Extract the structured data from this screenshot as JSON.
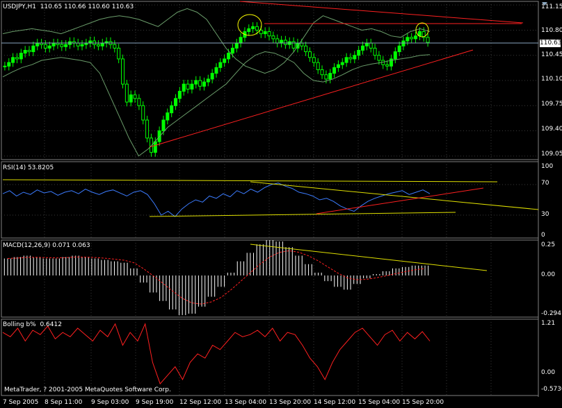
{
  "title": "USDJPY,H1  110.65 110.66 110.60 110.63",
  "current_price": "110.63",
  "copyright": "MetaTrader, ? 2001-2005 MetaQuotes Software Corp.",
  "x_labels": [
    "7 Sep 2005",
    "8 Sep 11:00",
    "9 Sep 03:00",
    "9 Sep 19:00",
    "12 Sep 12:00",
    "13 Sep 04:00",
    "13 Sep 20:00",
    "14 Sep 12:00",
    "15 Sep 04:00",
    "15 Sep 20:00"
  ],
  "panes": {
    "price": {
      "label": "USDJPY,H1  110.65 110.66 110.60 110.63",
      "ticks": [
        "111.15",
        "110.80",
        "110.45",
        "110.10",
        "109.75",
        "109.40",
        "109.05"
      ]
    },
    "rsi": {
      "label": "RSI(14) 53.8205",
      "ticks": [
        "100",
        "70",
        "30",
        "0"
      ]
    },
    "macd": {
      "label": "MACD(12,26,9) 0.071 0.063",
      "ticks": [
        "0.25",
        "0.00",
        "-0.294"
      ]
    },
    "bolling": {
      "label": "Bolling b%  0.6412",
      "ticks": [
        "1.21",
        "0.00",
        "-0.5736"
      ]
    }
  },
  "chart_data": [
    {
      "type": "candlestick",
      "title": "USDJPY,H1",
      "ohlc_last": {
        "open": 110.65,
        "high": 110.66,
        "low": 110.6,
        "close": 110.63
      },
      "ylim": [
        109.0,
        111.2
      ],
      "y_ticks": [
        111.15,
        110.8,
        110.45,
        110.1,
        109.75,
        109.4,
        109.05
      ],
      "x_tick_labels": [
        "7 Sep 2005",
        "8 Sep 11:00",
        "9 Sep 03:00",
        "9 Sep 19:00",
        "12 Sep 12:00",
        "13 Sep 04:00",
        "13 Sep 20:00",
        "14 Sep 12:00",
        "15 Sep 04:00",
        "15 Sep 20:00"
      ],
      "close_series": [
        110.3,
        110.35,
        110.42,
        110.4,
        110.48,
        110.52,
        110.5,
        110.58,
        110.62,
        110.6,
        110.55,
        110.58,
        110.62,
        110.6,
        110.57,
        110.6,
        110.64,
        110.62,
        110.58,
        110.6,
        110.62,
        110.65,
        110.6,
        110.58,
        110.62,
        110.64,
        110.6,
        110.55,
        110.4,
        110.05,
        109.8,
        109.9,
        109.85,
        109.75,
        109.55,
        109.3,
        109.1,
        109.25,
        109.4,
        109.55,
        109.65,
        109.75,
        109.85,
        109.95,
        110.05,
        109.98,
        110.05,
        110.1,
        110.02,
        110.08,
        110.12,
        110.2,
        110.28,
        110.35,
        110.4,
        110.48,
        110.55,
        110.62,
        110.7,
        110.78,
        110.82,
        110.85,
        110.8,
        110.75,
        110.78,
        110.72,
        110.68,
        110.62,
        110.66,
        110.6,
        110.64,
        110.55,
        110.62,
        110.58,
        110.5,
        110.42,
        110.35,
        110.25,
        110.18,
        110.12,
        110.2,
        110.28,
        110.32,
        110.35,
        110.42,
        110.4,
        110.45,
        110.52,
        110.58,
        110.62,
        110.55,
        110.45,
        110.38,
        110.32,
        110.3,
        110.4,
        110.5,
        110.58,
        110.65,
        110.7,
        110.68,
        110.72,
        110.78,
        110.7,
        110.63
      ],
      "bollinger": {
        "upper": [
          110.75,
          110.78,
          110.8,
          110.82,
          110.8,
          110.78,
          110.75,
          110.8,
          110.85,
          110.9,
          110.95,
          110.98,
          111.0,
          110.98,
          110.95,
          110.9,
          110.85,
          110.95,
          111.05,
          111.1,
          111.05,
          110.95,
          110.75,
          110.55,
          110.4,
          110.3,
          110.25,
          110.2,
          110.25,
          110.35,
          110.5,
          110.7,
          110.9,
          111.0,
          110.95,
          110.9,
          110.85,
          110.8,
          110.82,
          110.78,
          110.72,
          110.7,
          110.78,
          110.82,
          110.78
        ],
        "lower": [
          110.15,
          110.22,
          110.28,
          110.32,
          110.38,
          110.4,
          110.42,
          110.4,
          110.38,
          110.35,
          110.2,
          109.9,
          109.6,
          109.3,
          109.05,
          109.15,
          109.3,
          109.45,
          109.55,
          109.65,
          109.75,
          109.85,
          109.95,
          110.05,
          110.2,
          110.35,
          110.45,
          110.5,
          110.48,
          110.42,
          110.35,
          110.2,
          110.1,
          110.08,
          110.12,
          110.18,
          110.25,
          110.3,
          110.33,
          110.35,
          110.38,
          110.4,
          110.42,
          110.45,
          110.46
        ]
      },
      "trendlines": [
        {
          "color": "#ff0000",
          "from": [
            109.12
          ],
          "to": [
            110.55
          ]
        },
        {
          "color": "#ff0000",
          "from": [
            111.15
          ],
          "to": [
            110.92
          ]
        },
        {
          "color": "#ff0000",
          "from": [
            110.92
          ],
          "to": [
            110.92
          ]
        }
      ]
    },
    {
      "type": "line",
      "title": "RSI(14)",
      "last_value": 53.8205,
      "ylim": [
        0,
        100
      ],
      "y_ticks": [
        100,
        70,
        30,
        0
      ],
      "series": [
        {
          "values": [
            58,
            62,
            55,
            60,
            57,
            63,
            59,
            61,
            56,
            60,
            62,
            58,
            64,
            60,
            57,
            61,
            63,
            59,
            55,
            60,
            62,
            57,
            45,
            30,
            35,
            28,
            38,
            45,
            50,
            47,
            55,
            52,
            58,
            54,
            62,
            58,
            64,
            60,
            66,
            70,
            72,
            68,
            65,
            60,
            58,
            55,
            50,
            52,
            48,
            42,
            38,
            35,
            42,
            48,
            52,
            55,
            58,
            60,
            62,
            57,
            60,
            63,
            58
          ]
        }
      ]
    },
    {
      "type": "bar",
      "title": "MACD(12,26,9)",
      "last_values": [
        0.071,
        0.063
      ],
      "ylim": [
        -0.294,
        0.25
      ],
      "y_ticks": [
        0.25,
        0.0,
        -0.294
      ],
      "series": [
        {
          "values": [
            0.12,
            0.13,
            0.14,
            0.13,
            0.12,
            0.12,
            0.13,
            0.14,
            0.13,
            0.12,
            0.11,
            0.1,
            0.09,
            0.05,
            -0.05,
            -0.12,
            -0.18,
            -0.24,
            -0.28,
            -0.27,
            -0.22,
            -0.15,
            -0.08,
            0.02,
            0.1,
            0.16,
            0.22,
            0.25,
            0.24,
            0.2,
            0.14,
            0.08,
            0.02,
            -0.04,
            -0.08,
            -0.1,
            -0.06,
            -0.02,
            0.01,
            0.03,
            0.05,
            0.06,
            0.07,
            0.07
          ]
        }
      ]
    },
    {
      "type": "line",
      "title": "Bolling b%",
      "last_value": 0.6412,
      "ylim": [
        -0.5736,
        1.21
      ],
      "y_ticks": [
        1.21,
        0.0,
        -0.5736
      ],
      "series": [
        {
          "values": [
            0.9,
            0.8,
            1.0,
            0.7,
            0.95,
            0.85,
            1.05,
            0.75,
            0.9,
            0.8,
            1.0,
            0.85,
            0.7,
            0.95,
            0.8,
            1.1,
            0.6,
            0.9,
            0.7,
            1.1,
            0.2,
            -0.3,
            -0.1,
            0.1,
            -0.2,
            0.2,
            0.4,
            0.3,
            0.6,
            0.5,
            0.7,
            0.9,
            0.8,
            0.85,
            0.95,
            0.8,
            1.0,
            0.7,
            0.9,
            0.85,
            0.6,
            0.3,
            0.1,
            -0.2,
            0.2,
            0.5,
            0.7,
            0.9,
            1.0,
            0.8,
            0.6,
            0.85,
            0.95,
            0.7,
            0.9,
            0.75,
            0.92,
            0.7
          ]
        }
      ]
    }
  ]
}
